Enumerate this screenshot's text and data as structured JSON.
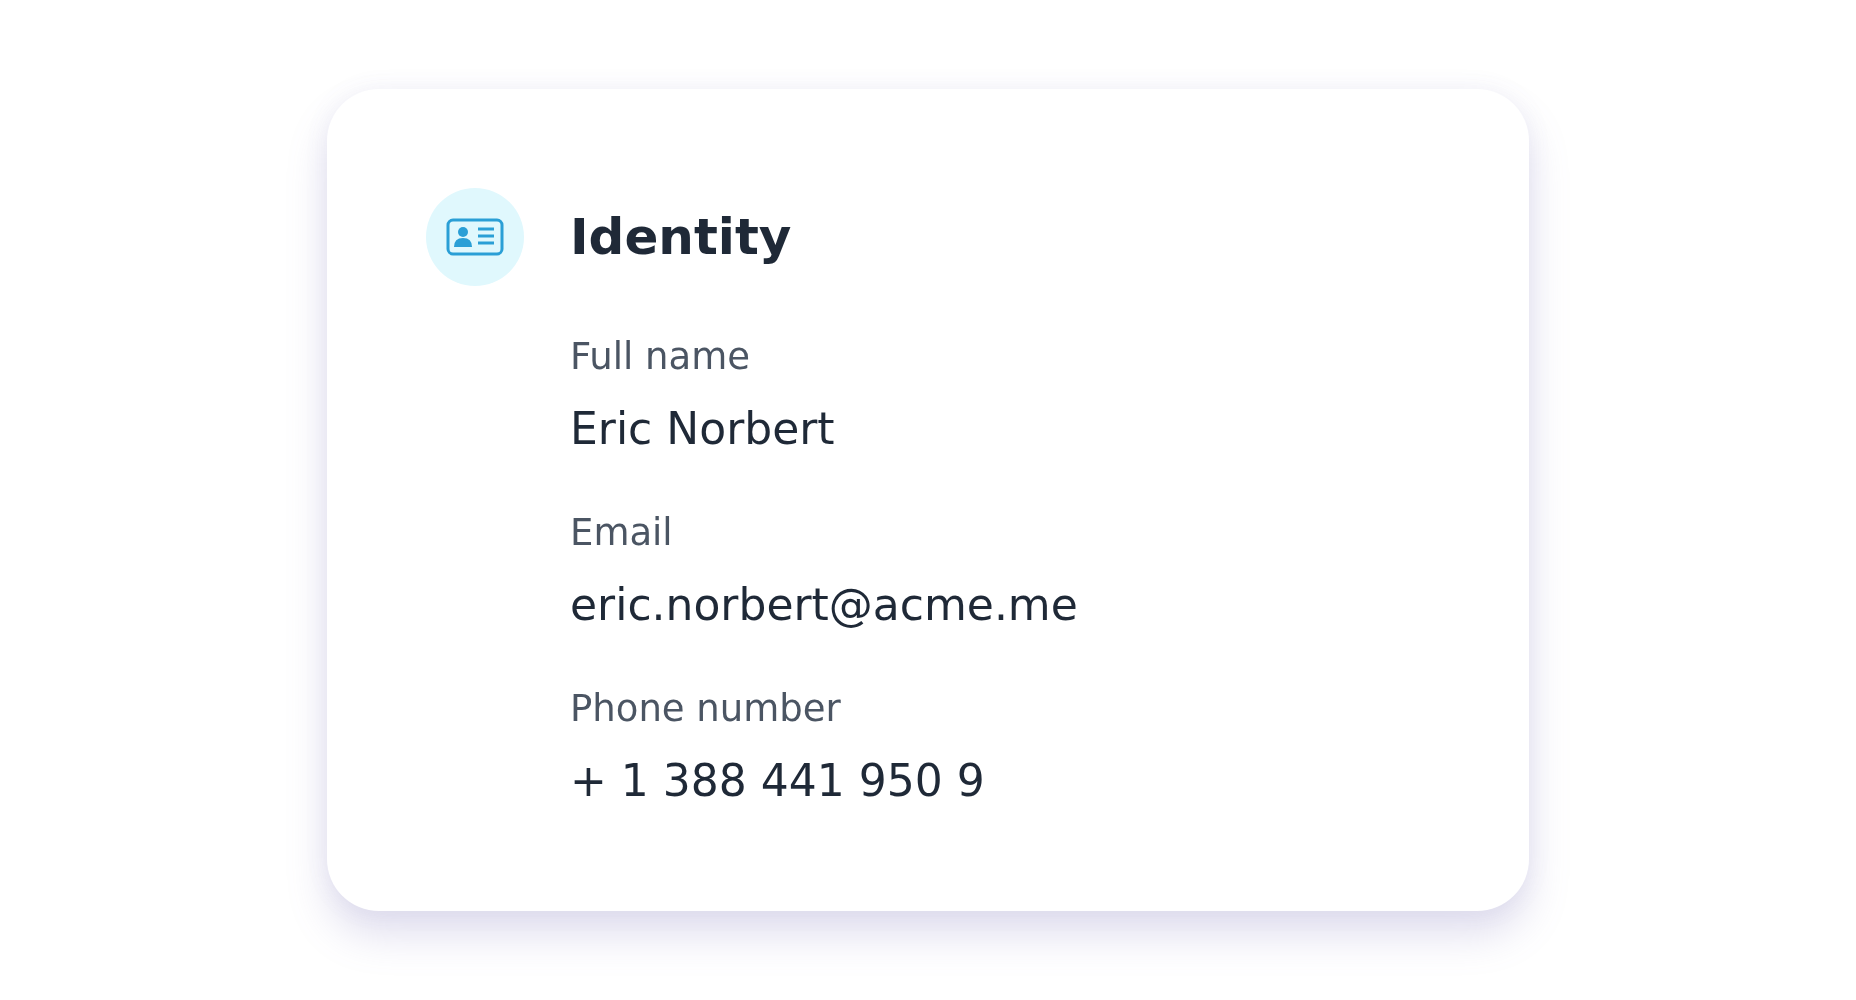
{
  "card": {
    "title": "Identity",
    "fields": [
      {
        "label": "Full name",
        "value": "Eric Norbert"
      },
      {
        "label": "Email",
        "value": "eric.norbert@acme.me"
      },
      {
        "label": "Phone number",
        "value": "+ 1 388 441 950 9"
      }
    ]
  }
}
